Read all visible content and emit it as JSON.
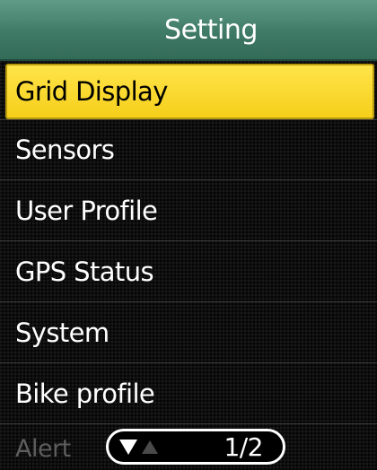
{
  "header": {
    "title": "Setting"
  },
  "menu": {
    "items": [
      {
        "label": "Grid Display",
        "selected": true
      },
      {
        "label": "Sensors",
        "selected": false
      },
      {
        "label": "User Profile",
        "selected": false
      },
      {
        "label": "GPS Status",
        "selected": false
      },
      {
        "label": "System",
        "selected": false
      },
      {
        "label": "Bike profile",
        "selected": false
      }
    ]
  },
  "footer": {
    "next_label": "Alert",
    "page_indicator": "1/2",
    "down_icon": "triangle-down-icon",
    "up_icon": "triangle-up-icon"
  },
  "colors": {
    "header_green": "#3f7a66",
    "selection_yellow": "#f5cf1a",
    "background": "#0d0d0d"
  }
}
